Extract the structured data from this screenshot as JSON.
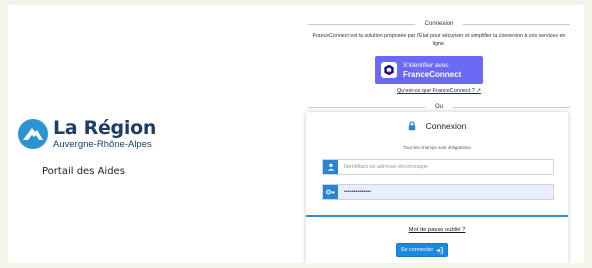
{
  "brand": {
    "name": "La Région",
    "subtitle": "Auvergne-Rhône-Alpes",
    "portal": "Portail des Aides",
    "color": "#1f3e66",
    "logo_color": "#2d94d0"
  },
  "franceconnect": {
    "section_title": "Connexion",
    "description": "FranceConnect est la solution proposée par l'État pour sécuriser et simplifier la connexion à vos services en ligne.",
    "button_line1": "S'identifier avec",
    "button_line2": "FranceConnect",
    "link": "Qu'est-ce que FranceConnect ? ↗",
    "button_color": "#6a6af4"
  },
  "separator": "Ou",
  "login": {
    "title": "Connexion",
    "required_note": "Tous les champs sont obligatoires",
    "identifier_placeholder": "Identifiant ou adresse électronique",
    "identifier_value": "",
    "password_value": "••••••••••••••",
    "forgot_label": "Mot de passe oublié ?",
    "submit_label": "Se connecter",
    "accent_color": "#1c89e0",
    "icons": {
      "title": "lock-icon",
      "user": "user-icon",
      "password": "key-icon",
      "submit": "sign-in-icon"
    }
  }
}
